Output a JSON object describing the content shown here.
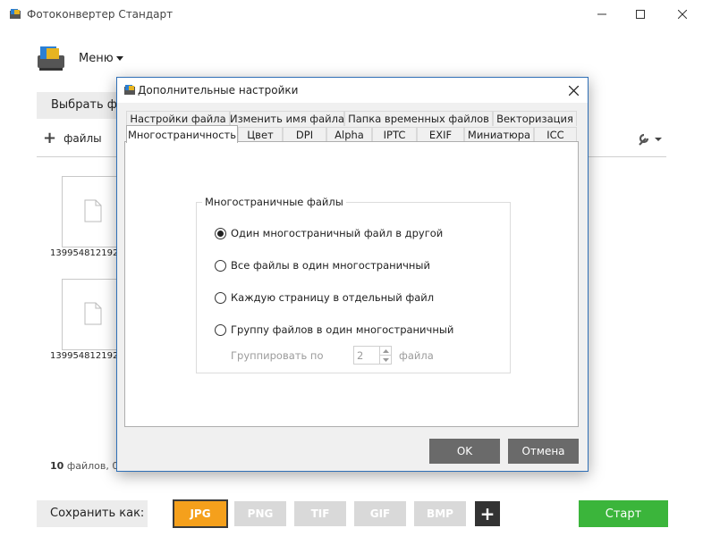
{
  "window": {
    "title": "Фотоконвертер Стандарт"
  },
  "toolbar": {
    "menu_label": "Меню",
    "select_label": "Выбрать файлы",
    "add_label": "файлы"
  },
  "thumbnails": [
    {
      "name": "1399548121920"
    },
    {
      "name": "1399548121920"
    }
  ],
  "status": {
    "count": "10",
    "text": "файлов, 0"
  },
  "bottom": {
    "save_as_label": "Сохранить как:",
    "formats": [
      "JPG",
      "PNG",
      "TIF",
      "GIF",
      "BMP"
    ],
    "selected_format": "JPG",
    "add_format_label": "+",
    "start_label": "Старт"
  },
  "dialog": {
    "title": "Дополнительные настройки",
    "tabs_row1": [
      "Настройки файла",
      "Изменить имя файла",
      "Папка временных файлов",
      "Векторизация"
    ],
    "tabs_row2": [
      "Многостраничность",
      "Цвет",
      "DPI",
      "Alpha",
      "IPTC",
      "EXIF",
      "Миниатюра",
      "ICC"
    ],
    "selected_tab": "Многостраничность",
    "group_title": "Многостраничные файлы",
    "options": [
      {
        "label": "Один многостраничный файл в другой",
        "checked": true
      },
      {
        "label": "Все файлы в один многостраничный",
        "checked": false
      },
      {
        "label": "Каждую страницу в отдельный файл",
        "checked": false
      },
      {
        "label": "Группу файлов в один многостраничный",
        "checked": false
      }
    ],
    "group_by_label": "Группировать по",
    "group_by_value": "2",
    "group_by_unit": "файла",
    "ok_label": "OK",
    "cancel_label": "Отмена"
  },
  "colors": {
    "accent": "#f5a01c",
    "start": "#3bb53b",
    "format_inactive": "#d9d9d9",
    "dialog_button": "#6a6a6a"
  }
}
